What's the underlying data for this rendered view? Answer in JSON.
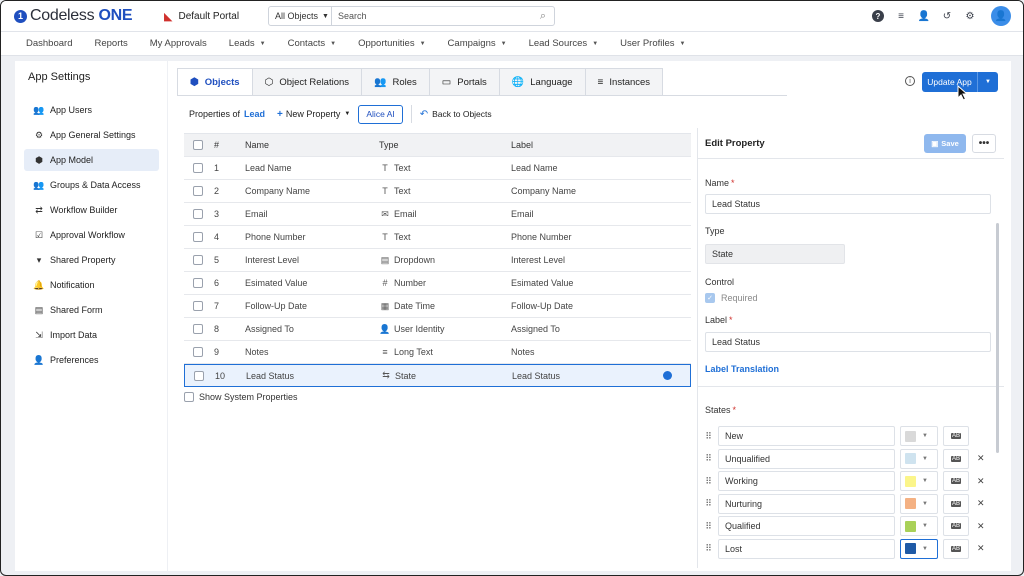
{
  "app": {
    "logo_prefix": "Codeless ",
    "logo_suffix": "ONE",
    "portal": "Default Portal"
  },
  "search": {
    "scope": "All Objects",
    "placeholder": "Search"
  },
  "nav": [
    "Dashboard",
    "Reports",
    "My Approvals",
    "Leads",
    "Contacts",
    "Opportunities",
    "Campaigns",
    "Lead Sources",
    "User Profiles"
  ],
  "nav_has_caret": [
    false,
    false,
    false,
    true,
    true,
    true,
    true,
    true,
    true
  ],
  "sidebar": {
    "title": "App Settings",
    "items": [
      {
        "label": "App Users",
        "icon": "users-icon",
        "glyph": "👥"
      },
      {
        "label": "App General Settings",
        "icon": "gear-icon",
        "glyph": "⚙"
      },
      {
        "label": "App Model",
        "icon": "cube-icon",
        "glyph": "⬢"
      },
      {
        "label": "Groups & Data Access",
        "icon": "group-icon",
        "glyph": "👥"
      },
      {
        "label": "Workflow Builder",
        "icon": "workflow-icon",
        "glyph": "⇄"
      },
      {
        "label": "Approval Workflow",
        "icon": "approval-icon",
        "glyph": "☑"
      },
      {
        "label": "Shared Property",
        "icon": "shared-property-icon",
        "glyph": "▾"
      },
      {
        "label": "Notification",
        "icon": "bell-icon",
        "glyph": "🔔"
      },
      {
        "label": "Shared Form",
        "icon": "form-icon",
        "glyph": "▤"
      },
      {
        "label": "Import Data",
        "icon": "import-icon",
        "glyph": "⇲"
      },
      {
        "label": "Preferences",
        "icon": "preferences-icon",
        "glyph": "👤"
      }
    ]
  },
  "tabs": [
    {
      "label": "Objects",
      "icon": "cube-icon",
      "glyph": "⬢"
    },
    {
      "label": "Object Relations",
      "icon": "relations-icon",
      "glyph": "⬡"
    },
    {
      "label": "Roles",
      "icon": "roles-icon",
      "glyph": "👥"
    },
    {
      "label": "Portals",
      "icon": "monitor-icon",
      "glyph": "▭"
    },
    {
      "label": "Language",
      "icon": "globe-icon",
      "glyph": "🌐"
    },
    {
      "label": "Instances",
      "icon": "database-icon",
      "glyph": "≡"
    }
  ],
  "update_button": "Update App",
  "toolbar": {
    "properties_of": "Properties of",
    "object": "Lead",
    "new_property": "New Property",
    "alice": "Alice AI",
    "back": "Back to Objects"
  },
  "table": {
    "headers": [
      "#",
      "Name",
      "Type",
      "Label"
    ],
    "rows": [
      {
        "num": "1",
        "name": "Lead Name",
        "type": "Text",
        "type_glyph": "T",
        "label": "Lead Name"
      },
      {
        "num": "2",
        "name": "Company Name",
        "type": "Text",
        "type_glyph": "T",
        "label": "Company Name"
      },
      {
        "num": "3",
        "name": "Email",
        "type": "Email",
        "type_glyph": "✉",
        "label": "Email"
      },
      {
        "num": "4",
        "name": "Phone Number",
        "type": "Text",
        "type_glyph": "T",
        "label": "Phone Number"
      },
      {
        "num": "5",
        "name": "Interest Level",
        "type": "Dropdown",
        "type_glyph": "▤",
        "label": "Interest Level"
      },
      {
        "num": "6",
        "name": "Esimated Value",
        "type": "Number",
        "type_glyph": "#",
        "label": "Esimated Value"
      },
      {
        "num": "7",
        "name": "Follow-Up Date",
        "type": "Date Time",
        "type_glyph": "▦",
        "label": "Follow-Up Date"
      },
      {
        "num": "8",
        "name": "Assigned To",
        "type": "User Identity",
        "type_glyph": "👤",
        "label": "Assigned To"
      },
      {
        "num": "9",
        "name": "Notes",
        "type": "Long Text",
        "type_glyph": "≡",
        "label": "Notes"
      },
      {
        "num": "10",
        "name": "Lead Status",
        "type": "State",
        "type_glyph": "⇆",
        "label": "Lead Status"
      }
    ],
    "show_system": "Show System Properties"
  },
  "edit": {
    "title": "Edit Property",
    "save": "Save",
    "name_label": "Name",
    "name_value": "Lead Status",
    "type_label": "Type",
    "type_value": "State",
    "control_label": "Control",
    "required_label": "Required",
    "label_label": "Label",
    "label_value": "Lead Status",
    "translation": "Label Translation",
    "states_label": "States",
    "states": [
      {
        "name": "New",
        "color": "#d9d9d9",
        "deletable": false
      },
      {
        "name": "Unqualified",
        "color": "#cfe3ef",
        "deletable": true
      },
      {
        "name": "Working",
        "color": "#fbf58a",
        "deletable": true
      },
      {
        "name": "Nurturing",
        "color": "#f4b183",
        "deletable": true
      },
      {
        "name": "Qualified",
        "color": "#a9d158",
        "deletable": true
      },
      {
        "name": "Lost",
        "color": "#1f5aa6",
        "deletable": true
      }
    ]
  }
}
